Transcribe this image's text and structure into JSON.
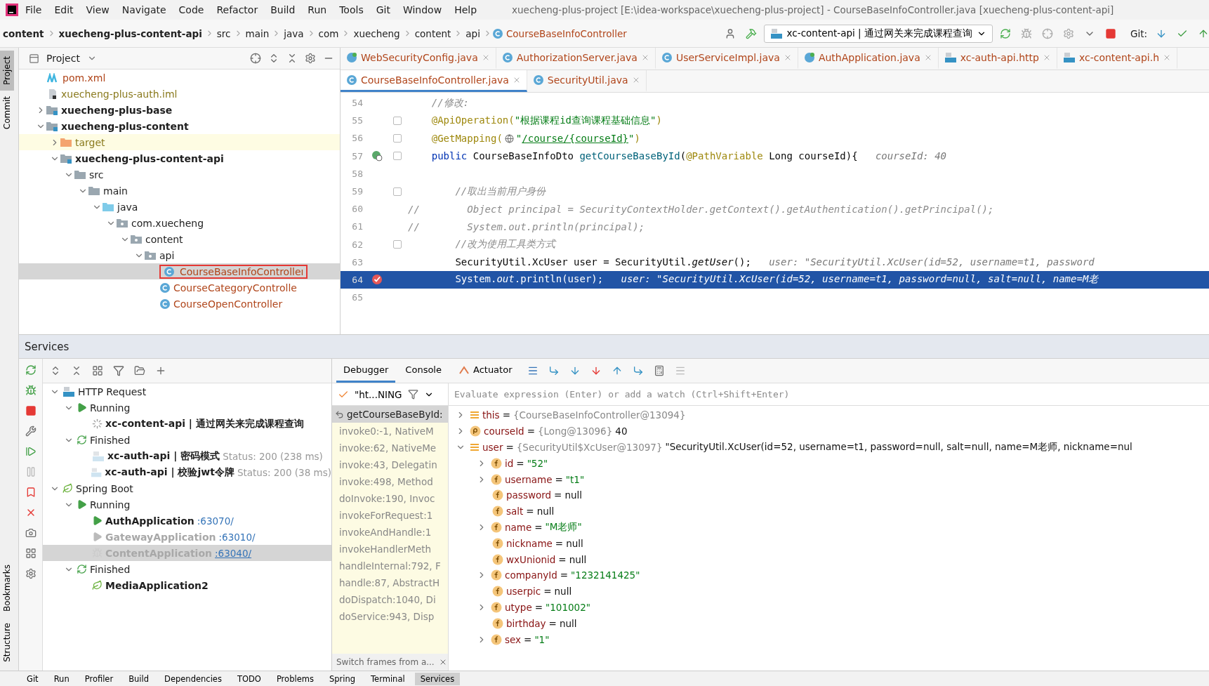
{
  "menu": [
    "File",
    "Edit",
    "View",
    "Navigate",
    "Code",
    "Refactor",
    "Build",
    "Run",
    "Tools",
    "Git",
    "Window",
    "Help"
  ],
  "window_title": "xuecheng-plus-project [E:\\idea-workspace\\xuecheng-plus-project] - CourseBaseInfoController.java [xuecheng-plus-content-api]",
  "breadcrumbs": [
    {
      "label": "content",
      "kind": "module"
    },
    {
      "label": "xuecheng-plus-content-api",
      "kind": "module"
    },
    {
      "label": "src",
      "kind": "plain"
    },
    {
      "label": "main",
      "kind": "plain"
    },
    {
      "label": "java",
      "kind": "plain"
    },
    {
      "label": "com",
      "kind": "plain"
    },
    {
      "label": "xuecheng",
      "kind": "plain"
    },
    {
      "label": "content",
      "kind": "plain"
    },
    {
      "label": "api",
      "kind": "plain"
    },
    {
      "label": "CourseBaseInfoController",
      "kind": "class"
    }
  ],
  "run_config": "xc-content-api | 通过网关来完成课程查询",
  "git_label": "Git:",
  "side_stripe": {
    "top": [
      {
        "label": "Project",
        "selected": true
      },
      {
        "label": "Commit",
        "selected": false
      }
    ],
    "bottom": [
      {
        "label": "Bookmarks",
        "selected": false
      },
      {
        "label": "Structure",
        "selected": false
      }
    ]
  },
  "project": {
    "title": "Project",
    "tree": [
      {
        "label": "pom.xml",
        "kind": "maven"
      },
      {
        "label": "xuecheng-plus-auth.iml",
        "kind": "iml"
      },
      {
        "label": "xuecheng-plus-base",
        "kind": "module",
        "expanded": false
      },
      {
        "label": "xuecheng-plus-content",
        "kind": "module",
        "expanded": true,
        "children": [
          {
            "label": "target",
            "kind": "excluded",
            "expanded": false
          },
          {
            "label": "xuecheng-plus-content-api",
            "kind": "module",
            "expanded": true,
            "children": [
              {
                "label": "src",
                "kind": "folder",
                "expanded": true,
                "children": [
                  {
                    "label": "main",
                    "kind": "folder",
                    "expanded": true,
                    "children": [
                      {
                        "label": "java",
                        "kind": "source",
                        "expanded": true,
                        "children": [
                          {
                            "label": "com.xuecheng",
                            "kind": "package",
                            "expanded": true,
                            "children": [
                              {
                                "label": "content",
                                "kind": "package",
                                "expanded": true,
                                "children": [
                                  {
                                    "label": "api",
                                    "kind": "package",
                                    "expanded": true,
                                    "children": [
                                      {
                                        "label": "CourseBaseInfoControlleı",
                                        "kind": "class",
                                        "selected": true
                                      },
                                      {
                                        "label": "CourseCategoryControlle",
                                        "kind": "class",
                                        "selected": false
                                      },
                                      {
                                        "label": "CourseOpenController",
                                        "kind": "class",
                                        "selected": false
                                      }
                                    ]
                                  }
                                ]
                              }
                            ]
                          }
                        ]
                      }
                    ]
                  }
                ]
              }
            ]
          }
        ]
      }
    ]
  },
  "editor": {
    "tab_rows": [
      [
        {
          "label": "WebSecurityConfig.java",
          "kind": "config",
          "selected": false
        },
        {
          "label": "AuthorizationServer.java",
          "kind": "class",
          "selected": false
        },
        {
          "label": "UserServiceImpl.java",
          "kind": "class",
          "selected": false
        },
        {
          "label": "AuthApplication.java",
          "kind": "config",
          "selected": false
        },
        {
          "label": "xc-auth-api.http",
          "kind": "api",
          "selected": false
        },
        {
          "label": "xc-content-api.h",
          "kind": "api",
          "selected": false
        }
      ],
      [
        {
          "label": "CourseBaseInfoController.java",
          "kind": "class",
          "selected": true
        },
        {
          "label": "SecurityUtil.java",
          "kind": "class",
          "selected": false
        }
      ]
    ],
    "lines": [
      {
        "number": "54",
        "kind": "code",
        "fold": false,
        "selected": false,
        "tokens": [
          {
            "kind": "comment",
            "text": "    //修改:"
          }
        ]
      },
      {
        "number": "55",
        "kind": "code",
        "fold": true,
        "selected": false,
        "tokens": [
          {
            "kind": "annotation",
            "text": "    @ApiOperation("
          },
          {
            "kind": "string",
            "text": "\"根据课程id查询课程基础信息\""
          },
          {
            "kind": "annotation",
            "text": ")"
          }
        ]
      },
      {
        "number": "56",
        "kind": "code",
        "fold": true,
        "selected": false,
        "tokens": [
          {
            "kind": "annotation",
            "text": "    @GetMapping("
          },
          {
            "kind": "globe"
          },
          {
            "kind": "string",
            "text": "\""
          },
          {
            "kind": "link",
            "text": "/course/{courseId}"
          },
          {
            "kind": "string",
            "text": "\""
          },
          {
            "kind": "annotation",
            "text": ")"
          }
        ]
      },
      {
        "number": "57",
        "kind": "endpoint",
        "fold": true,
        "selected": false,
        "tokens": [
          {
            "kind": "keyword",
            "text": "    public "
          },
          {
            "kind": "plain",
            "text": "CourseBaseInfoDto "
          },
          {
            "kind": "method",
            "text": "getCourseBaseById"
          },
          {
            "kind": "plain",
            "text": "("
          },
          {
            "kind": "annotation",
            "text": "@PathVariable"
          },
          {
            "kind": "plain",
            "text": " Long courseId){"
          },
          {
            "kind": "hint",
            "text": "   courseId: 40"
          }
        ]
      },
      {
        "number": "58",
        "kind": "code",
        "fold": false,
        "selected": false
      },
      {
        "number": "59",
        "kind": "code",
        "fold": true,
        "selected": false,
        "tokens": [
          {
            "kind": "comment",
            "text": "        //取出当前用户身份"
          }
        ]
      },
      {
        "number": "60",
        "kind": "code",
        "fold": false,
        "selected": false,
        "tokens": [
          {
            "kind": "comment",
            "text": "//        Object principal = SecurityContextHolder.getContext().getAuthentication().getPrincipal();"
          }
        ]
      },
      {
        "number": "61",
        "kind": "code",
        "fold": false,
        "selected": false,
        "tokens": [
          {
            "kind": "comment",
            "text": "//        System.out.println(principal);"
          }
        ]
      },
      {
        "number": "62",
        "kind": "code",
        "fold": true,
        "selected": false,
        "tokens": [
          {
            "kind": "comment",
            "text": "        //改为使用工具类方式"
          }
        ]
      },
      {
        "number": "63",
        "kind": "code",
        "fold": false,
        "selected": false,
        "tokens": [
          {
            "kind": "plain",
            "text": "        SecurityUtil.XcUser user = SecurityUtil."
          },
          {
            "kind": "static",
            "text": "getUser"
          },
          {
            "kind": "plain",
            "text": "();"
          },
          {
            "kind": "hint",
            "text": "   user: \"SecurityUtil.XcUser(id=52, username=t1, password"
          }
        ]
      },
      {
        "number": "64",
        "kind": "breakpoint",
        "fold": false,
        "selected": true,
        "tokens": [
          {
            "kind": "plain",
            "text": "        System."
          },
          {
            "kind": "field",
            "text": "out"
          },
          {
            "kind": "plain",
            "text": ".println(user);"
          },
          {
            "kind": "hint",
            "text": "   user: \"SecurityUtil.XcUser(id=52, username=t1, password=null, salt=null, name=M老"
          }
        ]
      },
      {
        "number": "65",
        "kind": "code",
        "fold": false,
        "selected": false
      }
    ]
  },
  "services": {
    "title": "Services",
    "tree": [
      {
        "label": "HTTP Request",
        "kind": "api",
        "expanded": true,
        "children": [
          {
            "label": "Running",
            "kind": "run",
            "expanded": true,
            "children": [
              {
                "label": "xc-content-api | 通过网关来完成课程查询",
                "kind": "spinner"
              }
            ]
          },
          {
            "label": "Finished",
            "kind": "finished",
            "expanded": true,
            "children": [
              {
                "label": "xc-auth-api | 密码模式",
                "status": "Status: 200 (238 ms)",
                "kind": "api-dim"
              },
              {
                "label": "xc-auth-api | 校验jwt令牌",
                "status": "Status: 200 (38 ms)",
                "kind": "api-dim"
              }
            ]
          }
        ]
      },
      {
        "label": "Spring Boot",
        "kind": "spring",
        "expanded": true,
        "children": [
          {
            "label": "Running",
            "kind": "run",
            "expanded": true,
            "children": [
              {
                "label": "AuthApplication",
                "port": ":63070/",
                "kind": "run",
                "disabled": false,
                "selected": false
              },
              {
                "label": "GatewayApplication",
                "port": ":63010/",
                "kind": "run-dim",
                "disabled": true,
                "selected": false
              },
              {
                "label": "ContentApplication",
                "port": ":63040/",
                "kind": "bug-dim",
                "disabled": true,
                "selected": true
              }
            ]
          },
          {
            "label": "Finished",
            "kind": "finished",
            "expanded": true,
            "children": [
              {
                "label": "MediaApplication2",
                "kind": "spring"
              }
            ]
          }
        ]
      }
    ]
  },
  "debugger": {
    "tabs": [
      {
        "label": "Debugger",
        "selected": true
      },
      {
        "label": "Console",
        "selected": false
      },
      {
        "label": "Actuator",
        "selected": false
      }
    ],
    "thread": "\"ht...NING",
    "evaluate_placeholder": "Evaluate expression (Enter) or add a watch (Ctrl+Shift+Enter)",
    "frames": [
      {
        "label": "getCourseBaseById:",
        "selected": true
      },
      {
        "label": "invoke0:-1, NativeM",
        "selected": false
      },
      {
        "label": "invoke:62, NativeMe",
        "selected": false
      },
      {
        "label": "invoke:43, Delegatin",
        "selected": false
      },
      {
        "label": "invoke:498, Method",
        "selected": false
      },
      {
        "label": "doInvoke:190, Invoc",
        "selected": false
      },
      {
        "label": "invokeForRequest:1",
        "selected": false
      },
      {
        "label": "invokeAndHandle:1",
        "selected": false
      },
      {
        "label": "invokeHandlerMeth",
        "selected": false
      },
      {
        "label": "handleInternal:792, F",
        "selected": false
      },
      {
        "label": "handle:87, AbstractH",
        "selected": false
      },
      {
        "label": "doDispatch:1040, Di",
        "selected": false
      },
      {
        "label": "doService:943, Disp",
        "selected": false
      }
    ],
    "switch_frames": "Switch frames from a...",
    "variables": [
      {
        "name": "this",
        "kind": "object",
        "expanded": false,
        "sep": "=",
        "ref": "{CourseBaseInfoController@13094}"
      },
      {
        "name": "courseId",
        "kind": "param",
        "expanded": false,
        "sep": "=",
        "ref": "{Long@13096}",
        "value": "40"
      },
      {
        "name": "user",
        "kind": "object",
        "expanded": true,
        "sep": "=",
        "ref": "{SecurityUtil$XcUser@13097}",
        "value": "\"SecurityUtil.XcUser(id=52, username=t1, password=null, salt=null, name=M老师, nickname=nul",
        "children": [
          {
            "name": "id",
            "kind": "field",
            "expanded": false,
            "sep": "=",
            "string": "\"52\""
          },
          {
            "name": "username",
            "kind": "field",
            "expanded": false,
            "sep": "=",
            "string": "\"t1\""
          },
          {
            "name": "password",
            "kind": "field",
            "sep": "=",
            "value": "null"
          },
          {
            "name": "salt",
            "kind": "field",
            "sep": "=",
            "value": "null"
          },
          {
            "name": "name",
            "kind": "field",
            "expanded": false,
            "sep": "=",
            "string": "\"M老师\""
          },
          {
            "name": "nickname",
            "kind": "field",
            "sep": "=",
            "value": "null"
          },
          {
            "name": "wxUnionid",
            "kind": "field",
            "sep": "=",
            "value": "null"
          },
          {
            "name": "companyId",
            "kind": "field",
            "expanded": false,
            "sep": "=",
            "string": "\"1232141425\""
          },
          {
            "name": "userpic",
            "kind": "field",
            "sep": "=",
            "value": "null"
          },
          {
            "name": "utype",
            "kind": "field",
            "expanded": false,
            "sep": "=",
            "string": "\"101002\""
          },
          {
            "name": "birthday",
            "kind": "field",
            "sep": "=",
            "value": "null"
          },
          {
            "name": "sex",
            "kind": "field",
            "expanded": false,
            "sep": "=",
            "string": "\"1\""
          }
        ]
      }
    ]
  },
  "tool_windows": [
    {
      "label": "Git",
      "selected": false
    },
    {
      "label": "Run",
      "selected": false
    },
    {
      "label": "Profiler",
      "selected": false
    },
    {
      "label": "Build",
      "selected": false
    },
    {
      "label": "Dependencies",
      "selected": false
    },
    {
      "label": "TODO",
      "selected": false
    },
    {
      "label": "Problems",
      "selected": false
    },
    {
      "label": "Spring",
      "selected": false
    },
    {
      "label": "Terminal",
      "selected": false
    },
    {
      "label": "Services",
      "selected": true
    }
  ]
}
